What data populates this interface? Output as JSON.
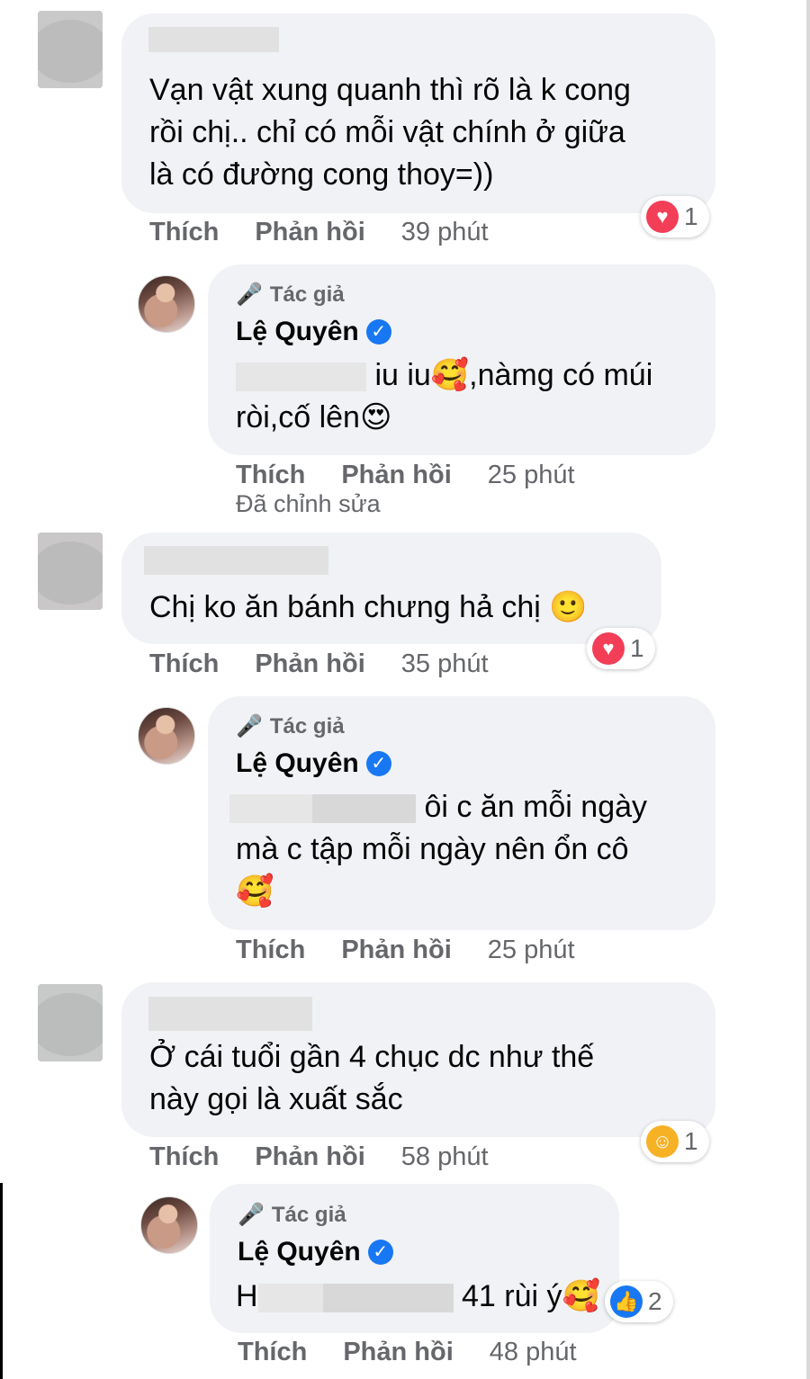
{
  "actions": {
    "like": "Thích",
    "reply": "Phản hồi"
  },
  "author_tag": "Tác giả",
  "edited_label": "Đã chỉnh sửa",
  "comments": [
    {
      "text_lines": [
        "Vạn vật xung quanh thì rõ là k cong",
        "rồi chị.. chỉ có mỗi vật chính ở giữa",
        "là có đường cong thoy=))"
      ],
      "time": "39 phút",
      "reaction": {
        "icon": "love-icon",
        "count": "1"
      }
    },
    {
      "author": "Lệ Quyên",
      "text_lines": [
        "iu iu🥰,nàmg có múi",
        "ròi,cố lên😍"
      ],
      "time": "25 phút",
      "edited": true
    },
    {
      "text_lines": [
        "Chị ko ăn bánh chưng hả chị 🙂"
      ],
      "time": "35 phút",
      "reaction": {
        "icon": "love-icon",
        "count": "1"
      }
    },
    {
      "author": "Lệ Quyên",
      "text_lines": [
        "ôi c ăn mỗi ngày",
        "mà c tập mỗi ngày nên ổn cô",
        "🥰"
      ],
      "time": "25 phút"
    },
    {
      "text_lines": [
        "Ở cái tuổi gần 4 chục dc như thế",
        "này gọi là xuất sắc"
      ],
      "time": "58 phút",
      "reaction": {
        "icon": "care-icon",
        "count": "1"
      }
    },
    {
      "author": "Lệ Quyên",
      "text_prefix": "H",
      "text_lines": [
        "41 rùi ý🥰"
      ],
      "time": "48 phút",
      "reaction": {
        "icon": "like-icon",
        "count": "2"
      }
    }
  ],
  "colors": {
    "love": "#f33e58",
    "like": "#1877f2",
    "care": "#f7b125",
    "bubble": "#f0f2f5"
  }
}
